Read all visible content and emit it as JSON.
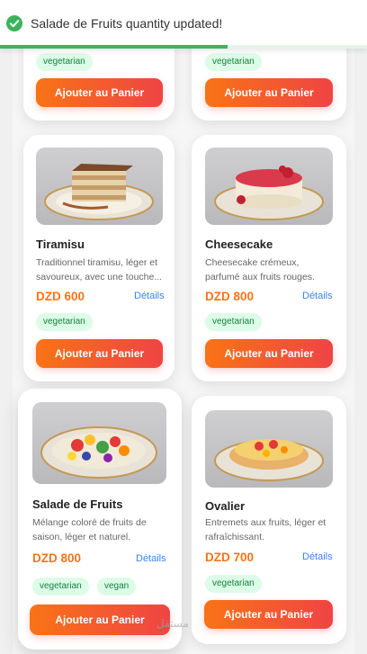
{
  "toast": {
    "message": "Salade de Fruits quantity updated!",
    "progress_remaining_percent": 62,
    "icon": "check-circle-icon",
    "color": "#3cb35b"
  },
  "theme": {
    "accent_start": "#f97316",
    "accent_end": "#ef4444",
    "tag_bg": "#dcfce7",
    "tag_text": "#15803d",
    "link": "#3b82f6"
  },
  "top_cards": [
    {
      "tags": [
        "vegetarian"
      ],
      "button_label": "Ajouter au Panier"
    },
    {
      "tags": [
        "vegetarian"
      ],
      "button_label": "Ajouter au Panier"
    }
  ],
  "products": [
    {
      "name": "Tiramisu",
      "description": "Traditionnel tiramisu, léger et savoureux, avec une touche...",
      "price": "DZD 600",
      "details_label": "Détails",
      "tags": [
        "vegetarian"
      ],
      "button_label": "Ajouter au Panier"
    },
    {
      "name": "Cheesecake",
      "description": "Cheesecake crémeux, parfumé aux fruits rouges.",
      "price": "DZD 800",
      "details_label": "Détails",
      "tags": [
        "vegetarian"
      ],
      "button_label": "Ajouter au Panier"
    },
    {
      "name": "Salade de Fruits",
      "description": "Mélange coloré de fruits de saison, léger et naturel.",
      "price": "DZD 800",
      "details_label": "Détails",
      "tags": [
        "vegetarian",
        "vegan"
      ],
      "button_label": "Ajouter au Panier"
    },
    {
      "name": "Ovalier",
      "description": "Entremets aux fruits, léger et rafraîchissant.",
      "price": "DZD 700",
      "details_label": "Détails",
      "tags": [
        "vegetarian"
      ],
      "button_label": "Ajouter au Panier"
    }
  ],
  "watermark": "مستقل"
}
